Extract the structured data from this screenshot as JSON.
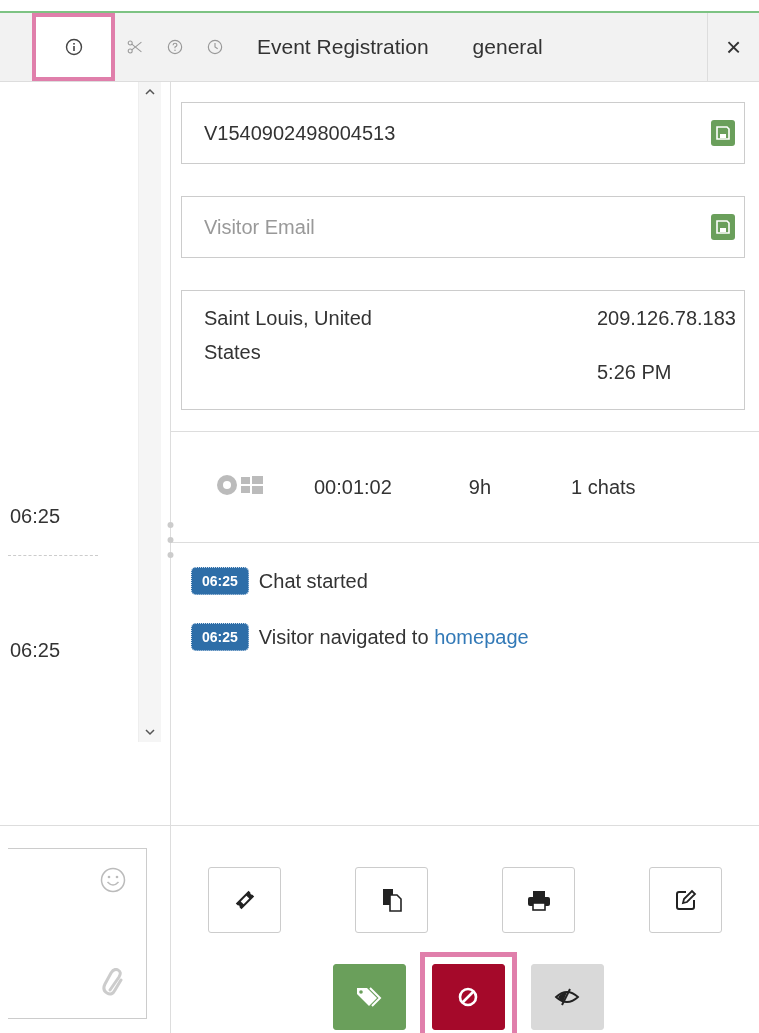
{
  "toolbar": {
    "tabs": [
      {
        "kind": "info",
        "selected": true,
        "highlighted": true
      },
      {
        "kind": "scissors",
        "selected": false,
        "highlighted": false
      },
      {
        "kind": "help",
        "selected": false,
        "highlighted": false
      },
      {
        "kind": "clock",
        "selected": false,
        "highlighted": false
      },
      {
        "kind": "text",
        "label": "Event Registration",
        "selected": false,
        "highlighted": false
      },
      {
        "kind": "text",
        "label": "general",
        "selected": false,
        "highlighted": false
      }
    ],
    "close": "×"
  },
  "messages": [
    {
      "time": "06:25"
    },
    {
      "time": "06:25"
    }
  ],
  "visitor": {
    "id_field": {
      "value": "V1540902498004513"
    },
    "email_field": {
      "placeholder": "Visitor Email"
    },
    "location": "Saint Louis, United States",
    "ip": "209.126.78.183",
    "local_time": "5:26 PM",
    "stats": {
      "duration": "00:01:02",
      "idle": "9h",
      "chats": "1 chats"
    },
    "events": [
      {
        "time": "06:25",
        "text": "Chat started"
      },
      {
        "time": "06:25",
        "text": "Visitor navigated to",
        "link": "homepage"
      }
    ]
  },
  "actions": {
    "rows": [
      [
        {
          "kind": "ticket",
          "highlighted": false
        },
        {
          "kind": "copy",
          "highlighted": false
        },
        {
          "kind": "print",
          "highlighted": false
        },
        {
          "kind": "edit",
          "highlighted": false
        }
      ],
      [
        {
          "kind": "tag",
          "highlighted": false
        },
        {
          "kind": "block",
          "highlighted": true
        },
        {
          "kind": "hide",
          "highlighted": false
        }
      ]
    ]
  }
}
